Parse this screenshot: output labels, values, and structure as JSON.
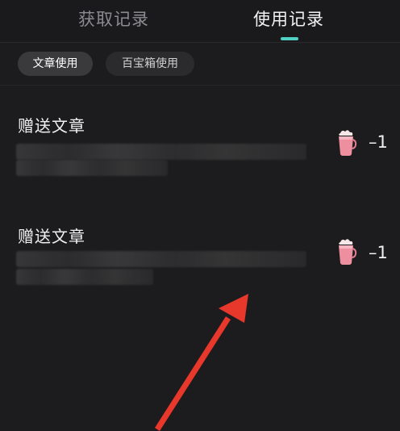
{
  "tabs": {
    "get_records": "获取记录",
    "use_records": "使用记录"
  },
  "filters": {
    "article_use": "文章使用",
    "treasure_box_use": "百宝箱使用"
  },
  "records": [
    {
      "title": "赠送文章",
      "amount": "–1",
      "icon": "cup-icon"
    },
    {
      "title": "赠送文章",
      "amount": "–1",
      "icon": "cup-icon"
    }
  ],
  "colors": {
    "background": "#1c1c1e",
    "tab_indicator": "#4fd1c5",
    "arrow": "#e8372b",
    "cup": "#ee8fa0"
  }
}
